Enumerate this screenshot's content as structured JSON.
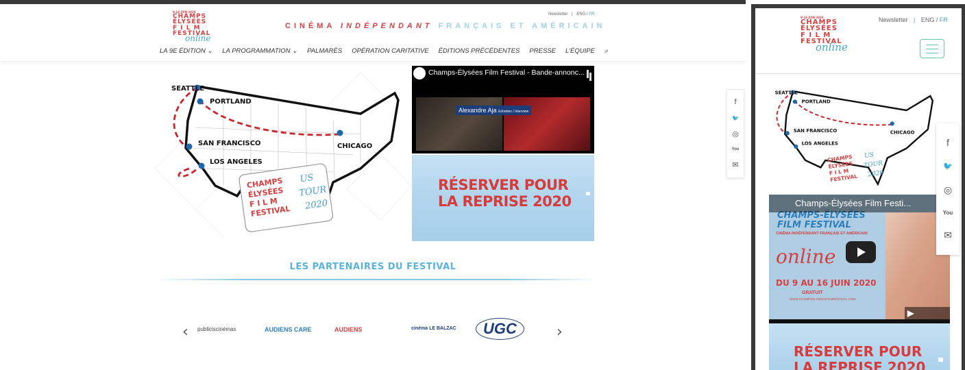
{
  "logo": {
    "small": "9-16 JUIN 2020",
    "line1": "CHAMPS",
    "line2": "ÉLYSÉES",
    "line3": "F I L M",
    "line4": "FESTIVAL",
    "online": "online"
  },
  "header": {
    "tagline_a": "CINÉMA",
    "tagline_b": "INDÉPENDANT",
    "tagline_c": "FRANÇAIS ET AMÉRICAIN",
    "newsletter": "Newsletter",
    "separator": "|",
    "lang_en": "ENG /",
    "lang_fr": "FR"
  },
  "nav": [
    {
      "label": "LA 9E ÉDITION ⌄"
    },
    {
      "label": "LA PROGRAMMATION ⌄"
    },
    {
      "label": "PALMARÈS"
    },
    {
      "label": "OPÉRATION CARITATIVE"
    },
    {
      "label": "ÉDITIONS PRÉCÉDENTES"
    },
    {
      "label": "PRESSE"
    },
    {
      "label": "L'ÉQUIPE"
    },
    {
      "label": "⌕"
    }
  ],
  "map": {
    "cities": [
      "SEATTLE",
      "PORTLAND",
      "SAN FRANCISCO",
      "LOS ANGELES",
      "CHICAGO"
    ],
    "badge_l1": "CHAMPS",
    "badge_l2": "ÉLYSÉES",
    "badge_l3": "F I L M",
    "badge_l4": "FESTIVAL",
    "badge_us": "US",
    "badge_tour": "TOUR",
    "badge_year": "2020"
  },
  "video": {
    "title": "Champs-Élysées Film Festival - Bande-annonc...",
    "lower_third_name": "Alexandre Aja",
    "lower_third_tag": "Entretien / Interview"
  },
  "banner": {
    "line1": "RÉSERVER POUR",
    "line2": "LA REPRISE 2020"
  },
  "social": {
    "icons": [
      "facebook-icon",
      "twitter-icon",
      "instagram-icon",
      "youtube-icon",
      "email-icon"
    ],
    "glyphs": [
      "f",
      "🐦",
      "◎",
      "You",
      "✉"
    ]
  },
  "partners": {
    "title": "LES PARTENAIRES DU FESTIVAL",
    "prev": "‹",
    "next": "›",
    "logos": [
      "publiciscinémas",
      "AUDIENS CARE",
      "AUDIENS",
      "cinéma LE BALZAC",
      "UGC"
    ]
  },
  "mobile": {
    "video_title": "Champs-Élysées Film Festi...",
    "poster_title_1": "CHAMPS-ÉLYSÉES",
    "poster_title_2": "FILM FESTIVAL",
    "poster_sub": "CINÉMA INDÉPENDANT FRANÇAIS ET AMÉRICAIN",
    "poster_online": "online",
    "poster_dates": "DU 9 AU 16 JUIN 2020",
    "poster_free": "GRATUIT",
    "poster_url": "WWW.CHAMPSELYSEESFILMFESTIVAL.COM",
    "youtube": "▶ YouTube",
    "banner_line1": "RÉSERVER POUR",
    "banner_line2": "LA REPRISE 2020"
  },
  "colors": {
    "brand_red": "#d64040",
    "brand_blue": "#48a6cf",
    "banner_sky": "#b3d6ee",
    "frame": "#3a3a3a"
  }
}
